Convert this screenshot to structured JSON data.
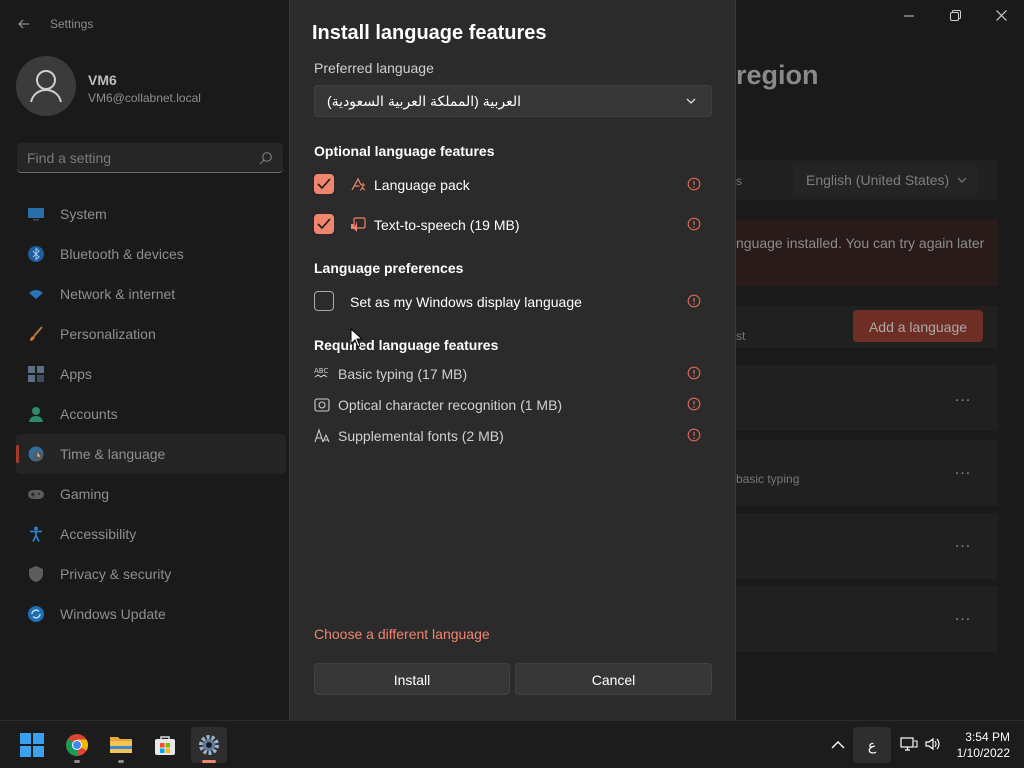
{
  "settings": {
    "app_title": "Settings",
    "user": {
      "name": "VM6",
      "email": "VM6@collabnet.local"
    },
    "search": {
      "placeholder": "Find a setting"
    },
    "nav": [
      {
        "label": "System",
        "icon": "monitor-icon"
      },
      {
        "label": "Bluetooth & devices",
        "icon": "bluetooth-icon"
      },
      {
        "label": "Network & internet",
        "icon": "wifi-icon"
      },
      {
        "label": "Personalization",
        "icon": "brush-icon"
      },
      {
        "label": "Apps",
        "icon": "apps-icon"
      },
      {
        "label": "Accounts",
        "icon": "person-icon"
      },
      {
        "label": "Time & language",
        "icon": "globe-clock-icon",
        "selected": true
      },
      {
        "label": "Gaming",
        "icon": "gamepad-icon"
      },
      {
        "label": "Accessibility",
        "icon": "accessibility-icon"
      },
      {
        "label": "Privacy & security",
        "icon": "shield-icon"
      },
      {
        "label": "Windows Update",
        "icon": "update-icon"
      }
    ],
    "page_title_fragment": "region",
    "regional_format_fragment": "s",
    "regional_value": "English (United States)",
    "error_fragment": "nguage installed. You can try again later",
    "list_fragment": "st",
    "add_language_label": "Add a language",
    "lang_row_detail_fragment": "basic typing",
    "more_label": "..."
  },
  "dialog": {
    "title": "Install language features",
    "preferred_language_label": "Preferred language",
    "selected_language": "العربية (المملكة العربية السعودية)",
    "optional_heading": "Optional language features",
    "optional_features": [
      {
        "label": "Language pack",
        "checked": true,
        "icon": "language-pack-icon"
      },
      {
        "label": "Text-to-speech (19 MB)",
        "checked": true,
        "icon": "text-to-speech-icon"
      }
    ],
    "preferences_heading": "Language preferences",
    "display_language_label": "Set as my Windows display language",
    "display_language_checked": false,
    "required_heading": "Required language features",
    "required_features": [
      {
        "label": "Basic typing (17 MB)",
        "icon": "abc-typing-icon"
      },
      {
        "label": "Optical character recognition (1 MB)",
        "icon": "ocr-icon"
      },
      {
        "label": "Supplemental fonts (2 MB)",
        "icon": "fonts-icon"
      }
    ],
    "different_language_link": "Choose a different language",
    "install_label": "Install",
    "cancel_label": "Cancel"
  },
  "taskbar": {
    "ime_indicator": "ع",
    "time": "3:54 PM",
    "date": "1/10/2022"
  },
  "colors": {
    "accent": "#f0846e",
    "dialog_bg": "#2b2b2b",
    "info_icon": "#e0685a"
  }
}
